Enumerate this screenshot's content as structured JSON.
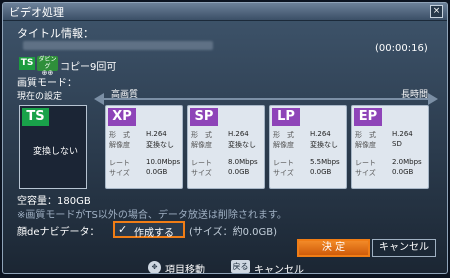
{
  "window": {
    "title": "ビデオ処理",
    "close_glyph": "×"
  },
  "info": {
    "title_label": "タイトル情報：",
    "duration": "(00:00:16)",
    "ts_badge": "TS",
    "dubbing_badge": "ダビング",
    "copy_info": "コピー9回可"
  },
  "quality": {
    "mode_label": "画質モード：",
    "current_label": "現在の設定",
    "high_label": "高画質",
    "long_label": "長時間",
    "current": {
      "badge": "TS",
      "text": "変換しない"
    },
    "row_labels": {
      "format": "形　式",
      "resolution": "解像度",
      "rate": "レート",
      "size": "サイズ"
    },
    "modes": [
      {
        "badge": "XP",
        "format": "H.264",
        "resolution": "変換なし",
        "rate": "10.0Mbps",
        "size": "0.0GB"
      },
      {
        "badge": "SP",
        "format": "H.264",
        "resolution": "変換なし",
        "rate": "8.0Mbps",
        "size": "0.0GB"
      },
      {
        "badge": "LP",
        "format": "H.264",
        "resolution": "変換なし",
        "rate": "5.5Mbps",
        "size": "0.0GB"
      },
      {
        "badge": "EP",
        "format": "H.264",
        "resolution": "SD",
        "rate": "2.0Mbps",
        "size": "0.0GB"
      }
    ],
    "free_space": "空容量：180GB",
    "note": "※画質モードがTS以外の場合、データ放送は削除されます。"
  },
  "navi": {
    "label": "顔deナビデータ：",
    "checkbox_mark": "✓",
    "checkbox_label": "作成する",
    "size_text": "(サイズ：約0.0GB)"
  },
  "buttons": {
    "ok": "決 定",
    "cancel": "キャンセル"
  },
  "footer": {
    "move_icon": "✥",
    "move_label": "項目移動",
    "back_key": "戻る",
    "back_label": "キャンセル"
  },
  "colors": {
    "accent": "#f07d16",
    "ts_green": "#19a24a",
    "mode_purple": "#8e44b8"
  }
}
